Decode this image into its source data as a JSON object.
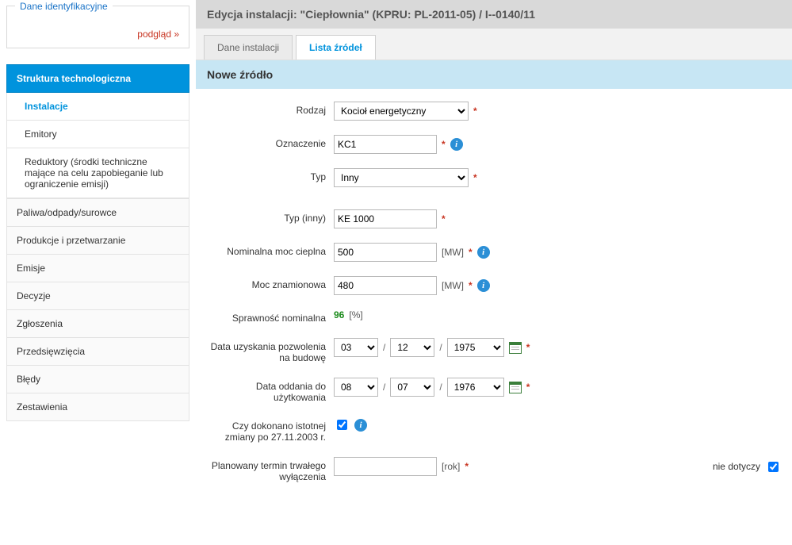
{
  "sidebar": {
    "card_title": "Dane identyfikacyjne",
    "card_link": "podgląd »",
    "head": "Struktura technologiczna",
    "submenu": [
      {
        "label": "Instalacje",
        "active": true
      },
      {
        "label": "Emitory"
      },
      {
        "label": "Reduktory (środki techniczne mające na celu zapobieganie lub ograniczenie emisji)"
      }
    ],
    "items": [
      "Paliwa/odpady/surowce",
      "Produkcje i przetwarzanie",
      "Emisje",
      "Decyzje",
      "Zgłoszenia",
      "Przedsięwzięcia",
      "Błędy",
      "Zestawienia"
    ]
  },
  "header": {
    "title": "Edycja instalacji: \"Ciepłownia\" (KPRU: PL-2011-05) / I--0140/11"
  },
  "tabs": [
    {
      "label": "Dane instalacji",
      "active": false
    },
    {
      "label": "Lista źródeł",
      "active": true
    }
  ],
  "section_title": "Nowe źródło",
  "form": {
    "rodzaj_label": "Rodzaj",
    "rodzaj_value": "Kocioł energetyczny",
    "oznaczenie_label": "Oznaczenie",
    "oznaczenie_value": "KC1",
    "typ_label": "Typ",
    "typ_value": "Inny",
    "typ_inny_label": "Typ (inny)",
    "typ_inny_value": "KE 1000",
    "nom_moc_label": "Nominalna moc cieplna",
    "nom_moc_value": "500",
    "nom_moc_unit": "[MW]",
    "moc_zn_label": "Moc znamionowa",
    "moc_zn_value": "480",
    "moc_zn_unit": "[MW]",
    "sprawnosc_label": "Sprawność nominalna",
    "sprawnosc_value": "96",
    "sprawnosc_unit": "[%]",
    "data_pozw_label": "Data uzyskania pozwolenia na budowę",
    "data_pozw": {
      "d": "03",
      "m": "12",
      "y": "1975"
    },
    "data_odd_label": "Data oddania do użytkowania",
    "data_odd": {
      "d": "08",
      "m": "07",
      "y": "1976"
    },
    "zmiana_label": "Czy dokonano istotnej zmiany po 27.11.2003 r.",
    "zmiana_checked": true,
    "plan_wyl_label": "Planowany termin trwałego wyłączenia",
    "plan_wyl_value": "",
    "plan_wyl_unit": "[rok]",
    "nie_dotyczy_label": "nie dotyczy",
    "nie_dotyczy_checked": true
  }
}
